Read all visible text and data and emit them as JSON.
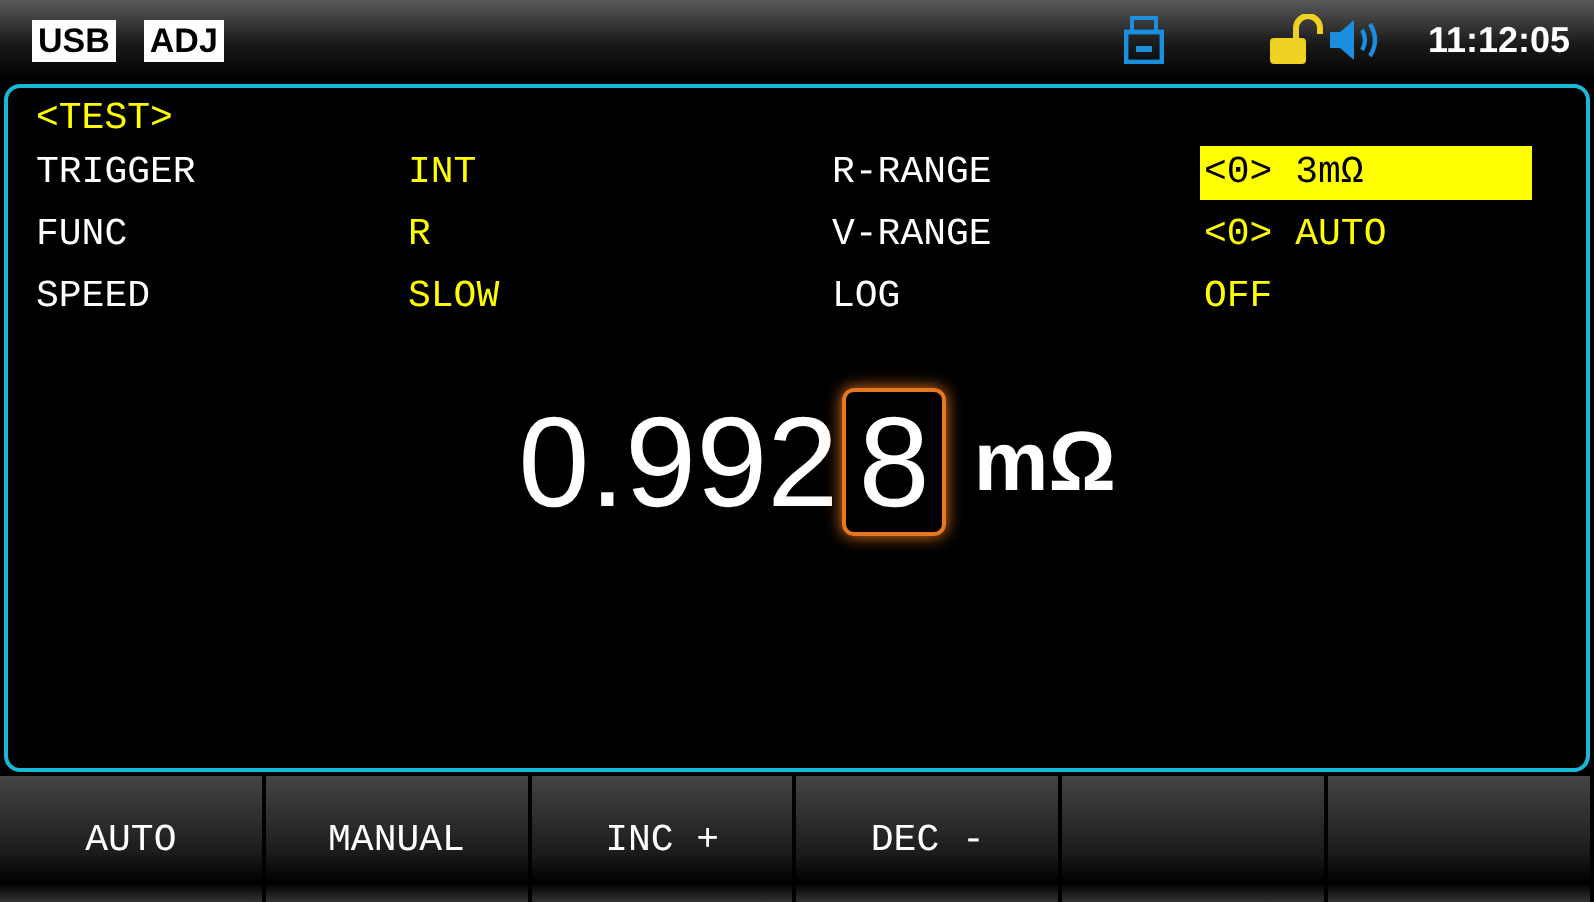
{
  "status_bar": {
    "badges": [
      "USB",
      "ADJ"
    ],
    "time": "11:12:05"
  },
  "panel": {
    "title": "<TEST>",
    "params": [
      {
        "label": "TRIGGER",
        "value": "INT",
        "selected": false
      },
      {
        "label": "R-RANGE",
        "value": "<0> 3mΩ",
        "selected": true
      },
      {
        "label": "FUNC",
        "value": "R",
        "selected": false
      },
      {
        "label": "V-RANGE",
        "value": "<0> AUTO",
        "selected": false
      },
      {
        "label": "SPEED",
        "value": "SLOW",
        "selected": false
      },
      {
        "label": "LOG",
        "value": "OFF",
        "selected": false
      }
    ],
    "reading": {
      "before_cursor": "0.992",
      "cursor_digit": "8",
      "unit": "mΩ"
    }
  },
  "softkeys": [
    {
      "kind": "label",
      "label": "AUTO"
    },
    {
      "kind": "label",
      "label": "MANUAL"
    },
    {
      "kind": "label",
      "label": "INC +"
    },
    {
      "kind": "label",
      "label": "DEC -"
    },
    {
      "kind": "blank"
    },
    {
      "kind": "blank"
    }
  ]
}
